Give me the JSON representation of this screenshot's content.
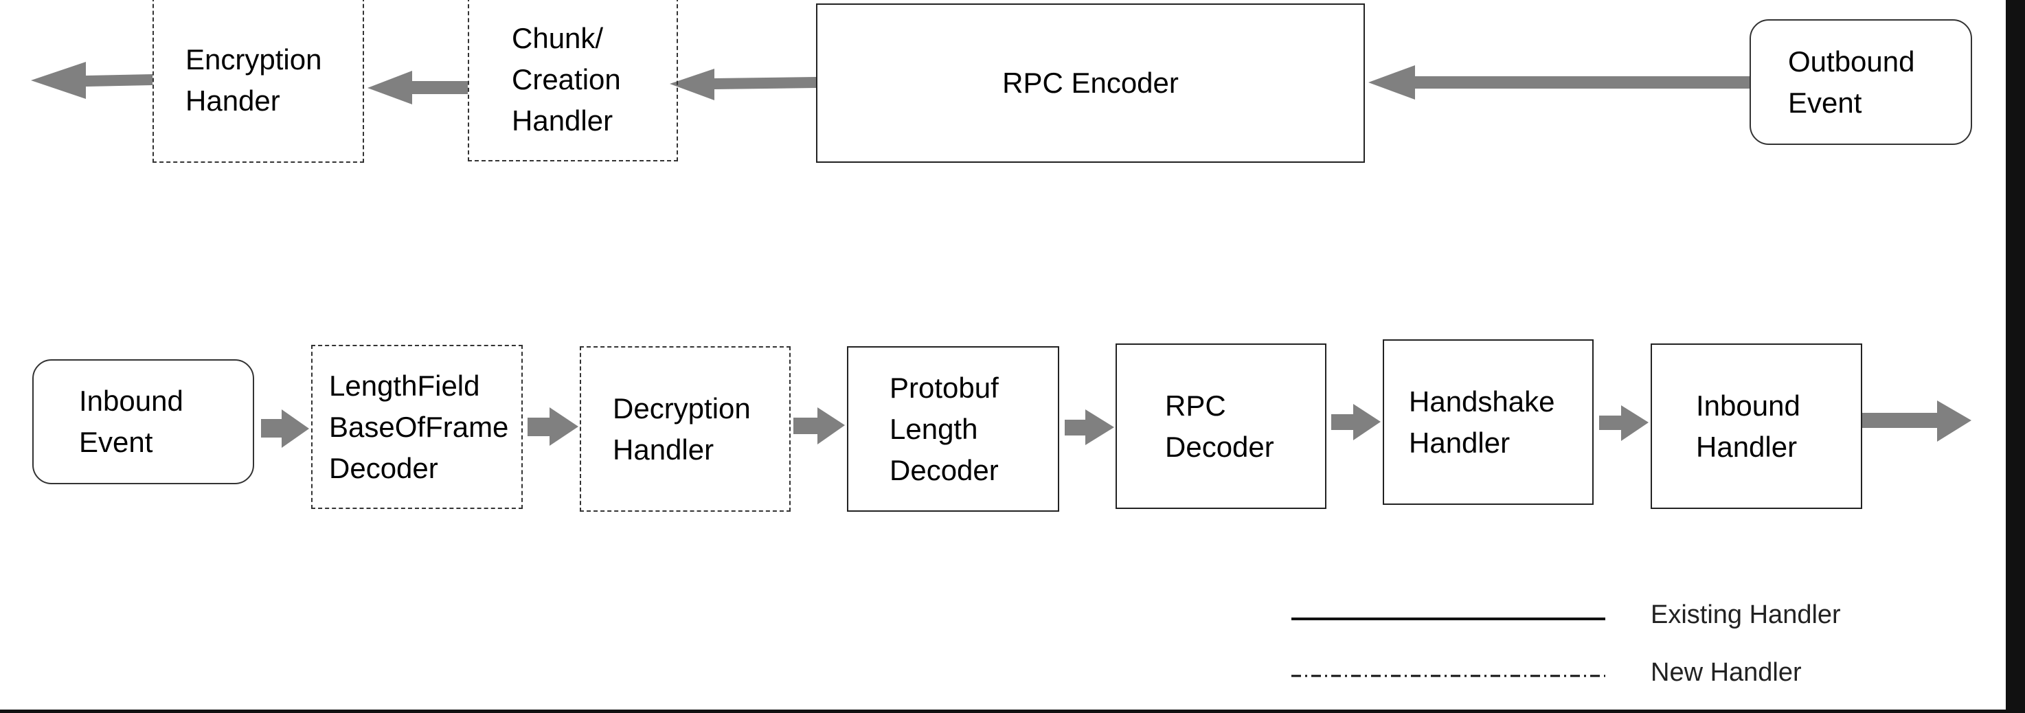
{
  "outbound_pipeline": {
    "nodes": [
      {
        "id": "encryption",
        "label": "Encryption\nHander",
        "type": "new"
      },
      {
        "id": "chunk",
        "label": "Chunk/\nCreation\nHandler",
        "type": "new"
      },
      {
        "id": "rpc_encoder",
        "label": "RPC Encoder",
        "type": "existing"
      },
      {
        "id": "outbound_event",
        "label": "Outbound\nEvent",
        "type": "event"
      }
    ]
  },
  "inbound_pipeline": {
    "nodes": [
      {
        "id": "inbound_event",
        "label": "Inbound\nEvent",
        "type": "event"
      },
      {
        "id": "lengthfield",
        "label": "LengthField\nBaseOfFrame\nDecoder",
        "type": "new"
      },
      {
        "id": "decryption",
        "label": "Decryption\nHandler",
        "type": "new"
      },
      {
        "id": "protobuf",
        "label": "Protobuf\nLength\nDecoder",
        "type": "existing"
      },
      {
        "id": "rpc_decoder",
        "label": "RPC\nDecoder",
        "type": "existing"
      },
      {
        "id": "handshake",
        "label": "Handshake\nHandler",
        "type": "existing"
      },
      {
        "id": "inbound_handler",
        "label": "Inbound\nHandler",
        "type": "existing"
      }
    ]
  },
  "legend": {
    "existing": "Existing Handler",
    "new": "New Handler"
  },
  "colors": {
    "arrow": "#808080",
    "border": "#222222"
  }
}
